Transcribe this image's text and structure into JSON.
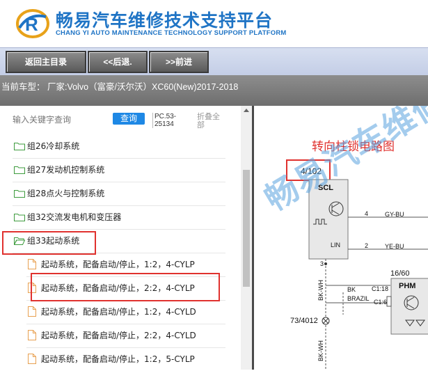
{
  "brand": {
    "name_cn": "畅易汽车维修技术支持平台",
    "name_en": "CHANG YI AUTO MAINTENANCE TECHNOLOGY SUPPORT PLATFORM",
    "logo_letter": "R",
    "colors": {
      "primary": "#1f74c5",
      "accent": "#e8a21a"
    }
  },
  "toolbar": {
    "home_label": "返回主目录",
    "back_label": "<<后退.",
    "forward_label": ">>前进"
  },
  "info": {
    "car_model": "当前车型： 厂家:Volvo（富豪/沃尔沃）XC60(New)2017-2018"
  },
  "search": {
    "placeholder": "输入关键字查询",
    "button_label": "查询",
    "pc_code": "PC.53-25134",
    "collapse_label": "折叠全部"
  },
  "tree": {
    "groups": [
      {
        "label": "组26冷却系统"
      },
      {
        "label": "组27发动机控制系统"
      },
      {
        "label": "组28点火与控制系统"
      },
      {
        "label": "组32交流发电机和变压器"
      },
      {
        "label": "组33起动系统",
        "expanded": true,
        "highlighted": true
      }
    ],
    "docs": [
      {
        "label": "起动系统，配备启动/停止，1:2，4-CYLP"
      },
      {
        "label": "起动系统，配备启动/停止，2:2，4-CYLP",
        "highlighted": true
      },
      {
        "label": "起动系统，配备启动/停止，1:2，4-CYLD"
      },
      {
        "label": "起动系统，配备启动/停止，2:2，4-CYLD"
      },
      {
        "label": "起动系统，配备启动/停止，1:2，5-CYLP"
      }
    ]
  },
  "diagram": {
    "title": "转向柱锁电路图",
    "watermark": "畅易汽车维修",
    "page_ref": "4/102",
    "module_scl": "SCL",
    "lin_label": "LIN",
    "pin4": "4",
    "pin2": "2",
    "pin3": "3",
    "wire_gy_bu": "GY-BU",
    "wire_ye_bu": "YE-BU",
    "wire_bk_wh": "BK-WH",
    "wire_bk": "BK",
    "wire_brazil": "BRAZIL",
    "conn_c1_18": "C1:18",
    "conn_c1_6": "C1:6",
    "ref_16_60": "16/60",
    "module_phm": "PHM",
    "ground_ref": "73/4012"
  }
}
